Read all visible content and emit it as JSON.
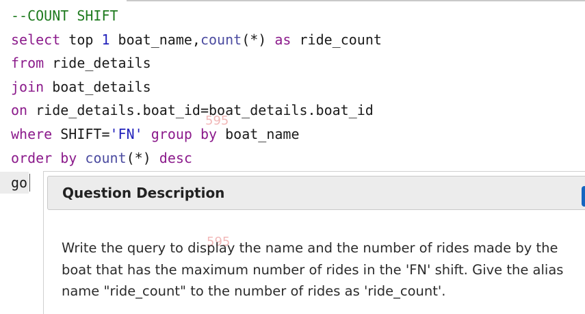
{
  "editor": {
    "lines": [
      [
        {
          "t": "--COUNT SHIFT",
          "k": "comment"
        }
      ],
      [
        {
          "t": "select",
          "k": "kw"
        },
        {
          "t": " top ",
          "k": "plain"
        },
        {
          "t": "1",
          "k": "num"
        },
        {
          "t": " boat_name,",
          "k": "plain"
        },
        {
          "t": "count",
          "k": "fn"
        },
        {
          "t": "(*) ",
          "k": "plain"
        },
        {
          "t": "as",
          "k": "kw"
        },
        {
          "t": " ride_count",
          "k": "plain"
        }
      ],
      [
        {
          "t": "from",
          "k": "kw"
        },
        {
          "t": " ride_details",
          "k": "plain"
        }
      ],
      [
        {
          "t": "join",
          "k": "kw"
        },
        {
          "t": " boat_details",
          "k": "plain"
        }
      ],
      [
        {
          "t": "on",
          "k": "kw"
        },
        {
          "t": " ride_details.boat_id=boat_details.boat_id",
          "k": "plain"
        }
      ],
      [
        {
          "t": "where",
          "k": "kw"
        },
        {
          "t": " SHIFT=",
          "k": "plain"
        },
        {
          "t": "'FN'",
          "k": "str"
        },
        {
          "t": " ",
          "k": "plain"
        },
        {
          "t": "group",
          "k": "kw"
        },
        {
          "t": " ",
          "k": "plain"
        },
        {
          "t": "by",
          "k": "kw"
        },
        {
          "t": " boat_name",
          "k": "plain"
        }
      ],
      [
        {
          "t": "order",
          "k": "kw"
        },
        {
          "t": " ",
          "k": "plain"
        },
        {
          "t": "by",
          "k": "kw"
        },
        {
          "t": " ",
          "k": "plain"
        },
        {
          "t": "count",
          "k": "fn"
        },
        {
          "t": "(*) ",
          "k": "plain"
        },
        {
          "t": "desc",
          "k": "kw"
        }
      ],
      [
        {
          "t": "go",
          "k": "plain"
        }
      ]
    ],
    "watermark": "595"
  },
  "question_panel": {
    "title": "Question Description",
    "description": "Write the query to display the name and the number of rides made by the boat that has the maximum number of rides in the 'FN' shift. Give the alias name \"ride_count\" to the number of rides as 'ride_count'.",
    "watermark": "595"
  },
  "icons": {
    "close_button_icon": "close-icon"
  },
  "colors": {
    "comment": "#1e7a1e",
    "keyword": "#8b1a8b",
    "function": "#4b4ba0",
    "literal": "#2222bb",
    "accent": "#1565c0"
  }
}
